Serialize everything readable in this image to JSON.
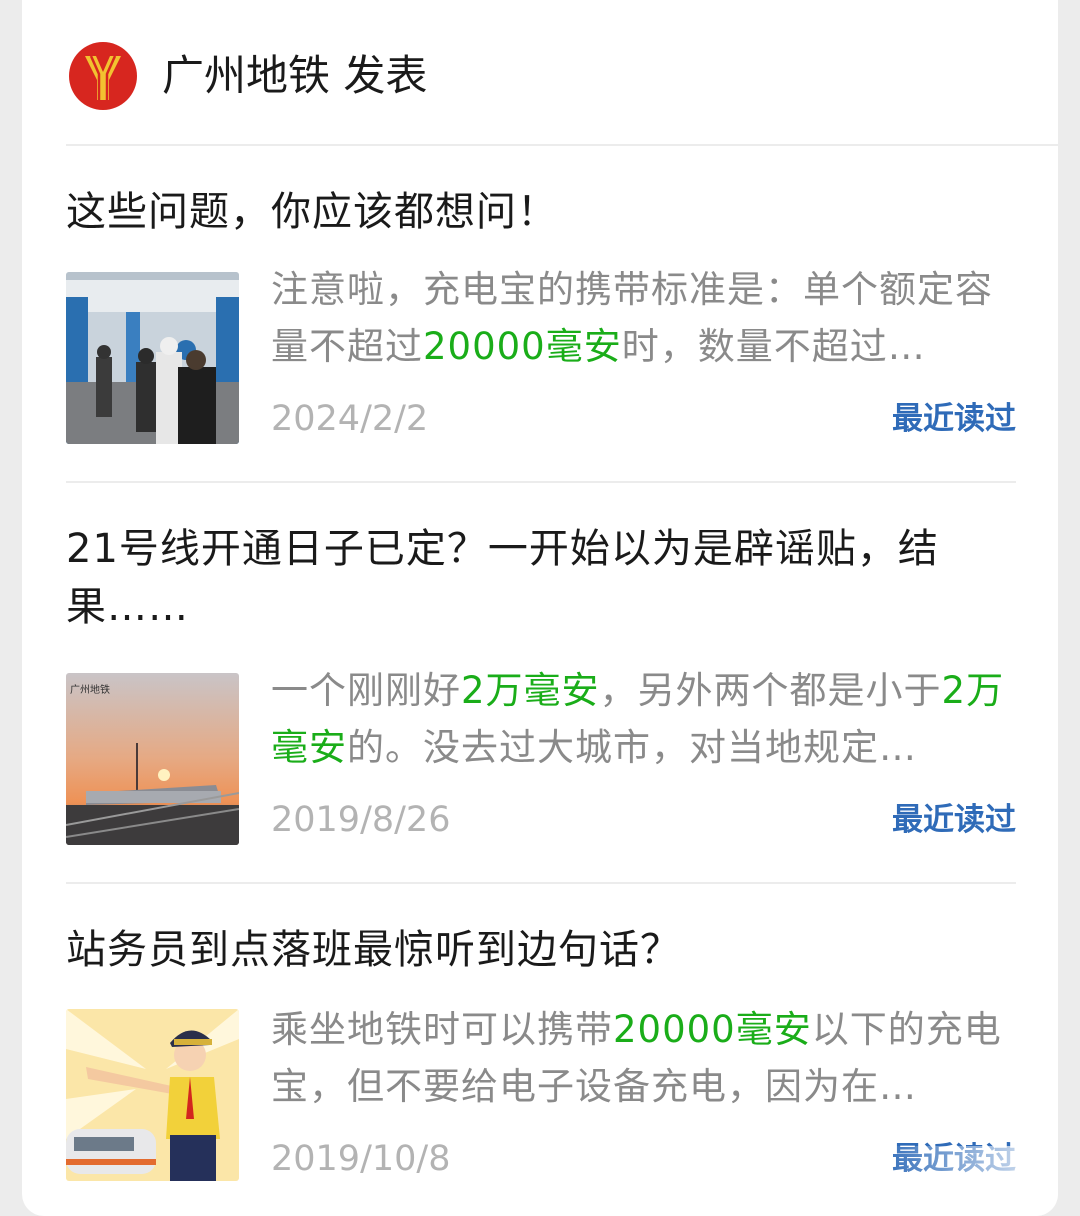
{
  "header": {
    "account_name": "广州地铁",
    "action": "发表"
  },
  "articles": [
    {
      "title": "这些问题，你应该都想问！",
      "excerpt": [
        {
          "text": "注意啦，充电宝的携带标准是：单个额定容量不超过",
          "hl": false
        },
        {
          "text": "20000毫安",
          "hl": true
        },
        {
          "text": "时，数量不超过…",
          "hl": false
        }
      ],
      "date": "2024/2/2",
      "recent_label": "最近读过",
      "thumb_icon": "metro-station-photo"
    },
    {
      "title": "21号线开通日子已定？一开始以为是辟谣贴，结果……",
      "excerpt": [
        {
          "text": "一个刚刚好",
          "hl": false
        },
        {
          "text": "2万毫安",
          "hl": true
        },
        {
          "text": "，另外两个都是小于",
          "hl": false
        },
        {
          "text": "2万毫安",
          "hl": true
        },
        {
          "text": "的。没去过大城市，对当地规定…",
          "hl": false
        }
      ],
      "date": "2019/8/26",
      "recent_label": "最近读过",
      "thumb_icon": "sunset-train-photo",
      "thumb_caption": "广州地铁"
    },
    {
      "title": "站务员到点落班最惊听到边句话？",
      "excerpt": [
        {
          "text": "乘坐地铁时可以携带",
          "hl": false
        },
        {
          "text": "20000毫安",
          "hl": true
        },
        {
          "text": "以下的充电宝，但不要给电子设备充电，因为在…",
          "hl": false
        }
      ],
      "date": "2019/10/8",
      "recent_label": "最近读过",
      "thumb_icon": "station-staff-illustration"
    }
  ],
  "colors": {
    "highlight": "#1aad19",
    "link": "#2f6bb8",
    "logo_red": "#d7261f",
    "logo_gold": "#f2c230"
  }
}
